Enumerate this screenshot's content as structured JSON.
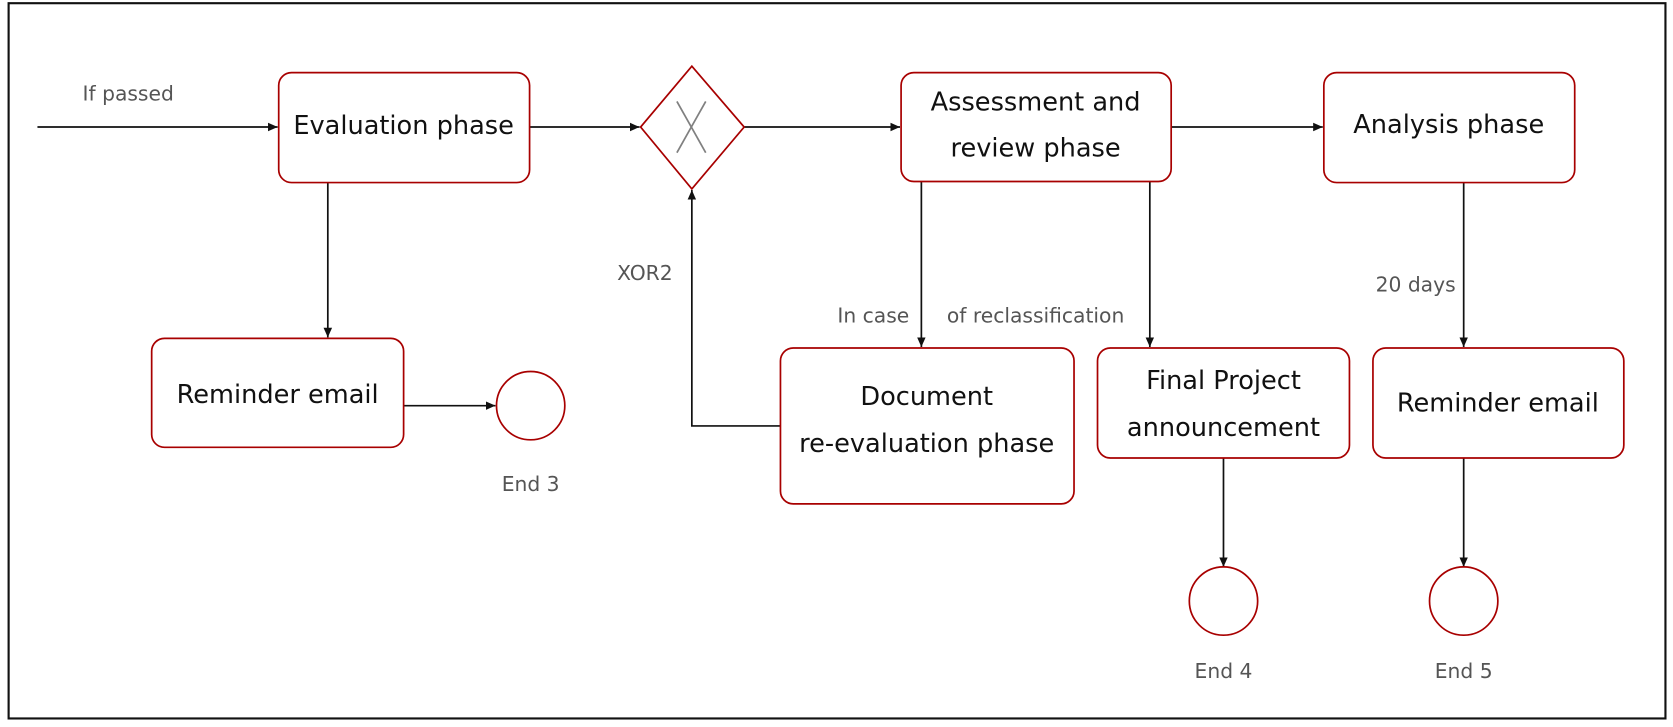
{
  "colors": {
    "task_border": "#a80000",
    "edge": "#111111",
    "label": "#555555",
    "gateway_mark": "#808080"
  },
  "nodes": {
    "evaluation": "Evaluation phase",
    "reminder1": "Reminder email",
    "gateway": {
      "type": "exclusive-gateway",
      "icon": "x-icon"
    },
    "assessment": [
      "Assessment and",
      "review phase"
    ],
    "analysis": "Analysis phase",
    "document": [
      "Document",
      "re-evaluation phase"
    ],
    "final": [
      "Final Project",
      "announcement"
    ],
    "reminder2": "Reminder email",
    "end3": "End 3",
    "end4": "End 4",
    "end5": "End 5"
  },
  "edge_labels": {
    "start": "If passed",
    "xor": "XOR2",
    "reclass_a": "In case",
    "reclass_b": "of reclassification",
    "days": "20 days"
  }
}
